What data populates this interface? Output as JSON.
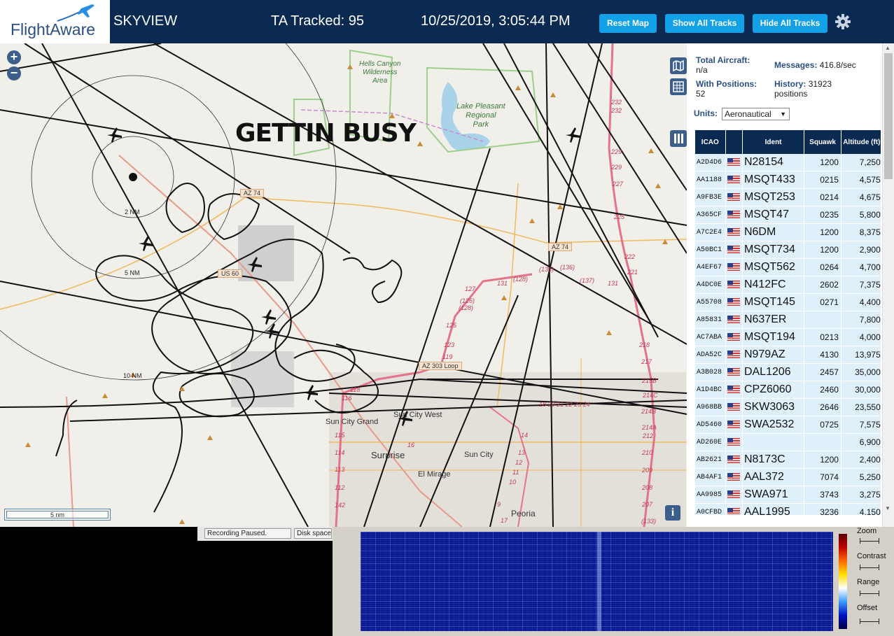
{
  "header": {
    "logo_text": "FlightAware",
    "app_name": "SKYVIEW",
    "tracked": "TA Tracked: 95",
    "datetime": "10/25/2019, 3:05:44 PM",
    "reset_map": "Reset Map",
    "show_all": "Show All Tracks",
    "hide_all": "Hide All Tracks",
    "settings_icon": "gear-icon"
  },
  "map": {
    "annotation": "GETTIN BUSY",
    "zoom_in": "+",
    "zoom_out": "−",
    "scale": "5 nm",
    "info": "i",
    "range_labels": [
      "2 NM",
      "5 NM",
      "10 NM"
    ],
    "places": [
      "Hells Canyon",
      "Wilderness",
      "Area",
      "Lake Pleasant",
      "Regional",
      "Park",
      "Sun City Grand",
      "Sun City West",
      "Surprise",
      "Sun City",
      "El Mirage",
      "Peoria"
    ],
    "shields": [
      "AZ 74",
      "AZ 74",
      "US 60",
      "AZ 303 Loop"
    ],
    "route_numbers": [
      "232",
      "232",
      "229",
      "229",
      "227",
      "225",
      "222",
      "221",
      "218",
      "217",
      "215B",
      "214C",
      "214B",
      "214A",
      "212",
      "210",
      "209",
      "208",
      "207",
      "(133)",
      "(135)",
      "(136)",
      "(137)",
      "131",
      "131",
      "(128)",
      "127",
      "(128)",
      "(126)",
      "125",
      "123",
      "119",
      "118",
      "116",
      "115",
      "114",
      "113",
      "112",
      "142",
      "16",
      "14",
      "13",
      "12",
      "11",
      "10",
      "9",
      "17",
      "18",
      "20",
      "21",
      "22",
      "23",
      "24"
    ]
  },
  "sidebar": {
    "total_label": "Total Aircraft:",
    "total_value": "n/a",
    "messages_label": "Messages:",
    "messages_value": "416.8/sec",
    "positions_label": "With Positions:",
    "positions_value": "52",
    "history_label": "History:",
    "history_value": "31923",
    "history_unit": "positions",
    "units_label": "Units:",
    "units_value": "Aeronautical",
    "columns": [
      "ICAO",
      "",
      "Ident",
      "Squawk",
      "Altitude (ft)"
    ],
    "rows": [
      {
        "icao": "A2D4D6",
        "ident": "N28154",
        "squawk": "1200",
        "alt": "7,250",
        "arrow": "▼"
      },
      {
        "icao": "AA1188",
        "ident": "MSQT433",
        "squawk": "0215",
        "alt": "4,575",
        "arrow": "▲"
      },
      {
        "icao": "A9FB3E",
        "ident": "MSQT253",
        "squawk": "0214",
        "alt": "4,675",
        "arrow": "▼"
      },
      {
        "icao": "A365CF",
        "ident": "MSQT47",
        "squawk": "0235",
        "alt": "5,800",
        "arrow": ""
      },
      {
        "icao": "A7C2E4",
        "ident": "N6DM",
        "squawk": "1200",
        "alt": "8,375",
        "arrow": ""
      },
      {
        "icao": "A50BC1",
        "ident": "MSQT734",
        "squawk": "1200",
        "alt": "2,900",
        "arrow": "▲"
      },
      {
        "icao": "A4EF67",
        "ident": "MSQT562",
        "squawk": "0264",
        "alt": "4,700",
        "arrow": ""
      },
      {
        "icao": "A4DC0E",
        "ident": "N412FC",
        "squawk": "2602",
        "alt": "7,375",
        "arrow": ""
      },
      {
        "icao": "A55708",
        "ident": "MSQT145",
        "squawk": "0271",
        "alt": "4,400",
        "arrow": "▼"
      },
      {
        "icao": "A85831",
        "ident": "N637ER",
        "squawk": "",
        "alt": "7,800",
        "arrow": ""
      },
      {
        "icao": "AC7ABA",
        "ident": "MSQT194",
        "squawk": "0213",
        "alt": "4,000",
        "arrow": "▼"
      },
      {
        "icao": "ADA52C",
        "ident": "N979AZ",
        "squawk": "4130",
        "alt": "13,975",
        "arrow": "▲"
      },
      {
        "icao": "A3B028",
        "ident": "DAL1206",
        "squawk": "2457",
        "alt": "35,000",
        "arrow": ""
      },
      {
        "icao": "A1D4BC",
        "ident": "CPZ6060",
        "squawk": "2460",
        "alt": "30,000",
        "arrow": ""
      },
      {
        "icao": "A968BB",
        "ident": "SKW3063",
        "squawk": "2646",
        "alt": "23,550",
        "arrow": "▲"
      },
      {
        "icao": "AD5460",
        "ident": "SWA2532",
        "squawk": "0725",
        "alt": "7,575",
        "arrow": "▼"
      },
      {
        "icao": "AD260E",
        "ident": "",
        "squawk": "",
        "alt": "6,900",
        "arrow": ""
      },
      {
        "icao": "AB2621",
        "ident": "N8173C",
        "squawk": "1200",
        "alt": "2,400",
        "arrow": ""
      },
      {
        "icao": "AB4AF1",
        "ident": "AAL372",
        "squawk": "7074",
        "alt": "5,250",
        "arrow": "▼"
      },
      {
        "icao": "AA9985",
        "ident": "SWA971",
        "squawk": "3743",
        "alt": "3,275",
        "arrow": "▼"
      },
      {
        "icao": "A0CFBD",
        "ident": "AAL1995",
        "squawk": "3236",
        "alt": "4,150",
        "arrow": "▼"
      }
    ]
  },
  "bottom": {
    "recording": "Recording Paused.",
    "disk": "Disk space",
    "zoom": "Zoom",
    "contrast": "Contrast",
    "range": "Range",
    "offset": "Offset"
  },
  "colors": {
    "header_bg": "#0a2a52",
    "button": "#12a0e6",
    "table_row": "#dff0fa",
    "map_bg": "#f1efe9",
    "water": "#a9d3e8"
  }
}
